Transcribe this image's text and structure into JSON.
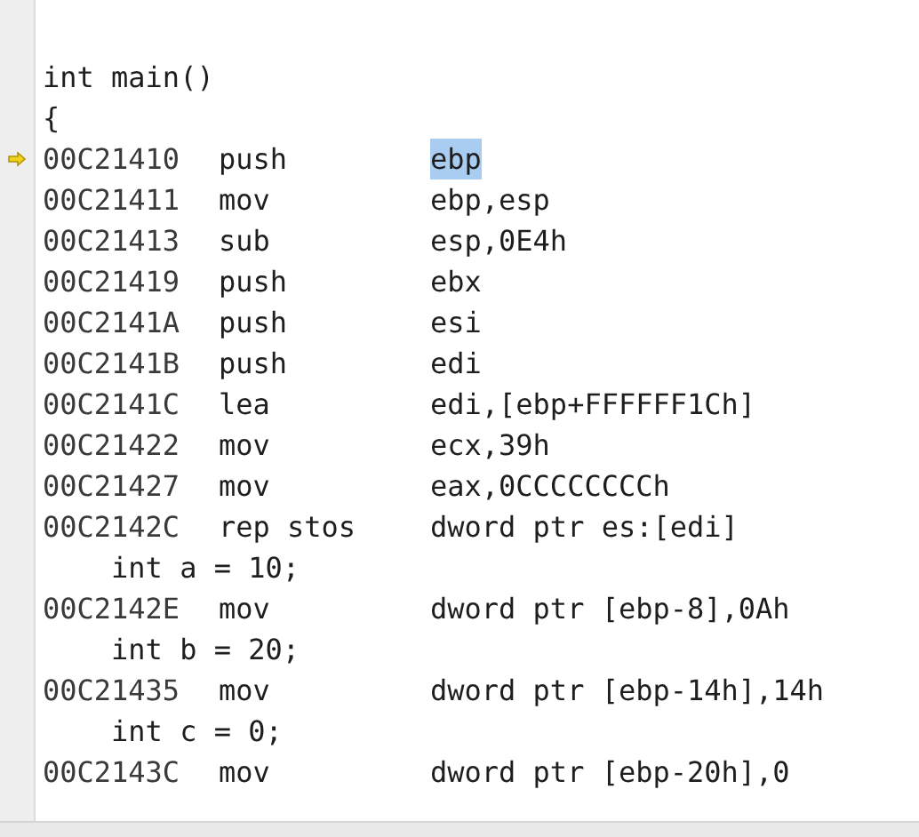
{
  "lines": [
    {
      "kind": "source",
      "text": "int main()"
    },
    {
      "kind": "source",
      "text": "{"
    },
    {
      "kind": "asm",
      "address": "00C21410",
      "mnemonic": "push",
      "operands": "ebp",
      "current": true,
      "operand_selected": true
    },
    {
      "kind": "asm",
      "address": "00C21411",
      "mnemonic": "mov",
      "operands": "ebp,esp",
      "current": false,
      "operand_selected": false
    },
    {
      "kind": "asm",
      "address": "00C21413",
      "mnemonic": "sub",
      "operands": "esp,0E4h",
      "current": false,
      "operand_selected": false
    },
    {
      "kind": "asm",
      "address": "00C21419",
      "mnemonic": "push",
      "operands": "ebx",
      "current": false,
      "operand_selected": false
    },
    {
      "kind": "asm",
      "address": "00C2141A",
      "mnemonic": "push",
      "operands": "esi",
      "current": false,
      "operand_selected": false
    },
    {
      "kind": "asm",
      "address": "00C2141B",
      "mnemonic": "push",
      "operands": "edi",
      "current": false,
      "operand_selected": false
    },
    {
      "kind": "asm",
      "address": "00C2141C",
      "mnemonic": "lea",
      "operands": "edi,[ebp+FFFFFF1Ch]",
      "current": false,
      "operand_selected": false
    },
    {
      "kind": "asm",
      "address": "00C21422",
      "mnemonic": "mov",
      "operands": "ecx,39h",
      "current": false,
      "operand_selected": false
    },
    {
      "kind": "asm",
      "address": "00C21427",
      "mnemonic": "mov",
      "operands": "eax,0CCCCCCCCh",
      "current": false,
      "operand_selected": false
    },
    {
      "kind": "asm",
      "address": "00C2142C",
      "mnemonic": "rep stos",
      "operands": "dword ptr es:[edi]",
      "current": false,
      "operand_selected": false
    },
    {
      "kind": "source",
      "text": "    int a = 10;"
    },
    {
      "kind": "asm",
      "address": "00C2142E",
      "mnemonic": "mov",
      "operands": "dword ptr [ebp-8],0Ah",
      "current": false,
      "operand_selected": false
    },
    {
      "kind": "source",
      "text": "    int b = 20;"
    },
    {
      "kind": "asm",
      "address": "00C21435",
      "mnemonic": "mov",
      "operands": "dword ptr [ebp-14h],14h",
      "current": false,
      "operand_selected": false
    },
    {
      "kind": "source",
      "text": "    int c = 0;"
    },
    {
      "kind": "asm",
      "address": "00C2143C",
      "mnemonic": "mov",
      "operands": "dword ptr [ebp-20h],0",
      "current": false,
      "operand_selected": false
    }
  ]
}
